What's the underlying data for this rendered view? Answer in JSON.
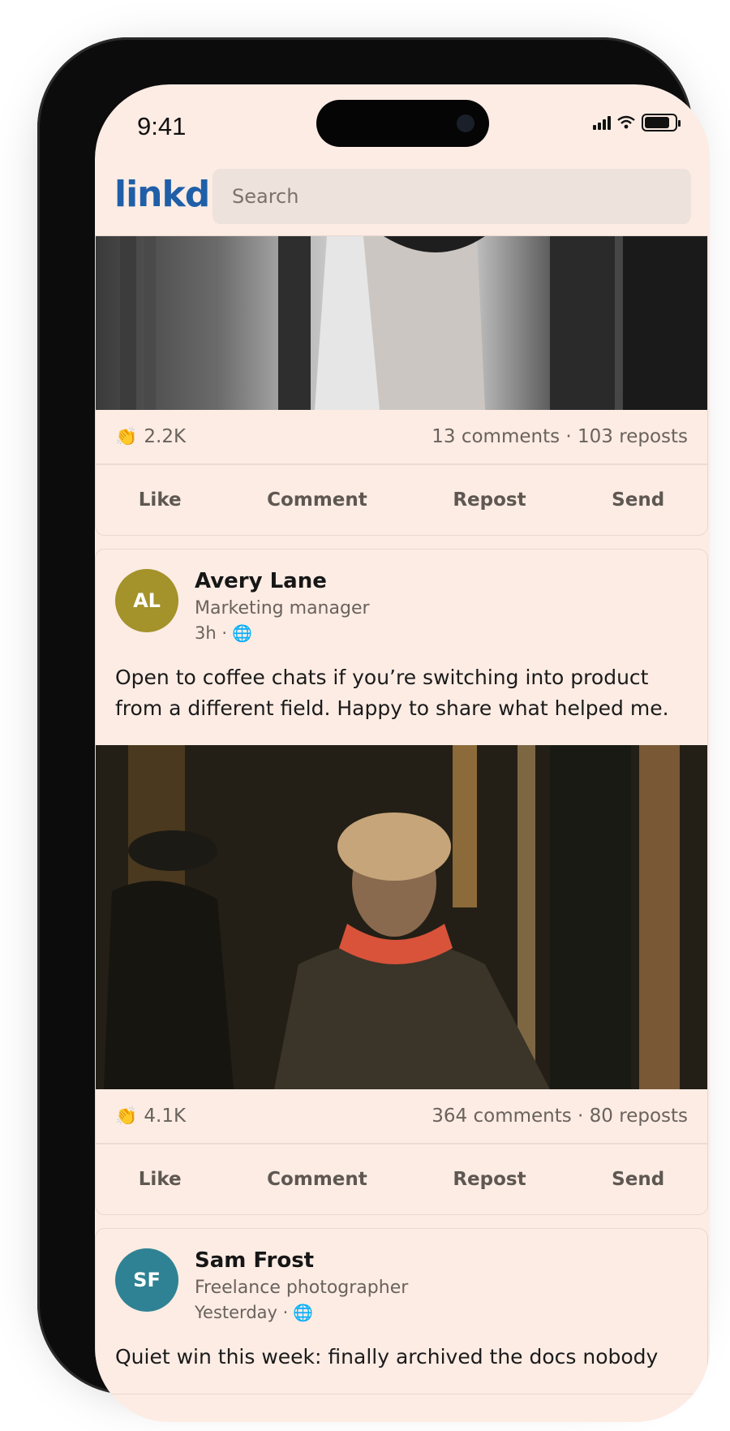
{
  "status": {
    "time": "9:41"
  },
  "header": {
    "logo": "linkd",
    "search_placeholder": "Search"
  },
  "posts": [
    {
      "reactions": "2.2K",
      "meta": "13 comments · 103 reposts"
    },
    {
      "initials": "AL",
      "avatar_color": "#a4922a",
      "name": "Avery Lane",
      "role": "Marketing manager",
      "time": "3h ·",
      "text": "Open to coffee chats if you’re switching into product from a different field. Happy to share what helped me.",
      "reactions": "4.1K",
      "meta": "364 comments · 80 reposts"
    },
    {
      "initials": "SF",
      "avatar_color": "#2e8293",
      "name": "Sam Frost",
      "role": "Freelance photographer",
      "time": "Yesterday ·",
      "text": "Quiet win this week: finally archived the docs nobody"
    }
  ],
  "actions": {
    "like": "Like",
    "comment": "Comment",
    "repost": "Repost",
    "send": "Send"
  }
}
